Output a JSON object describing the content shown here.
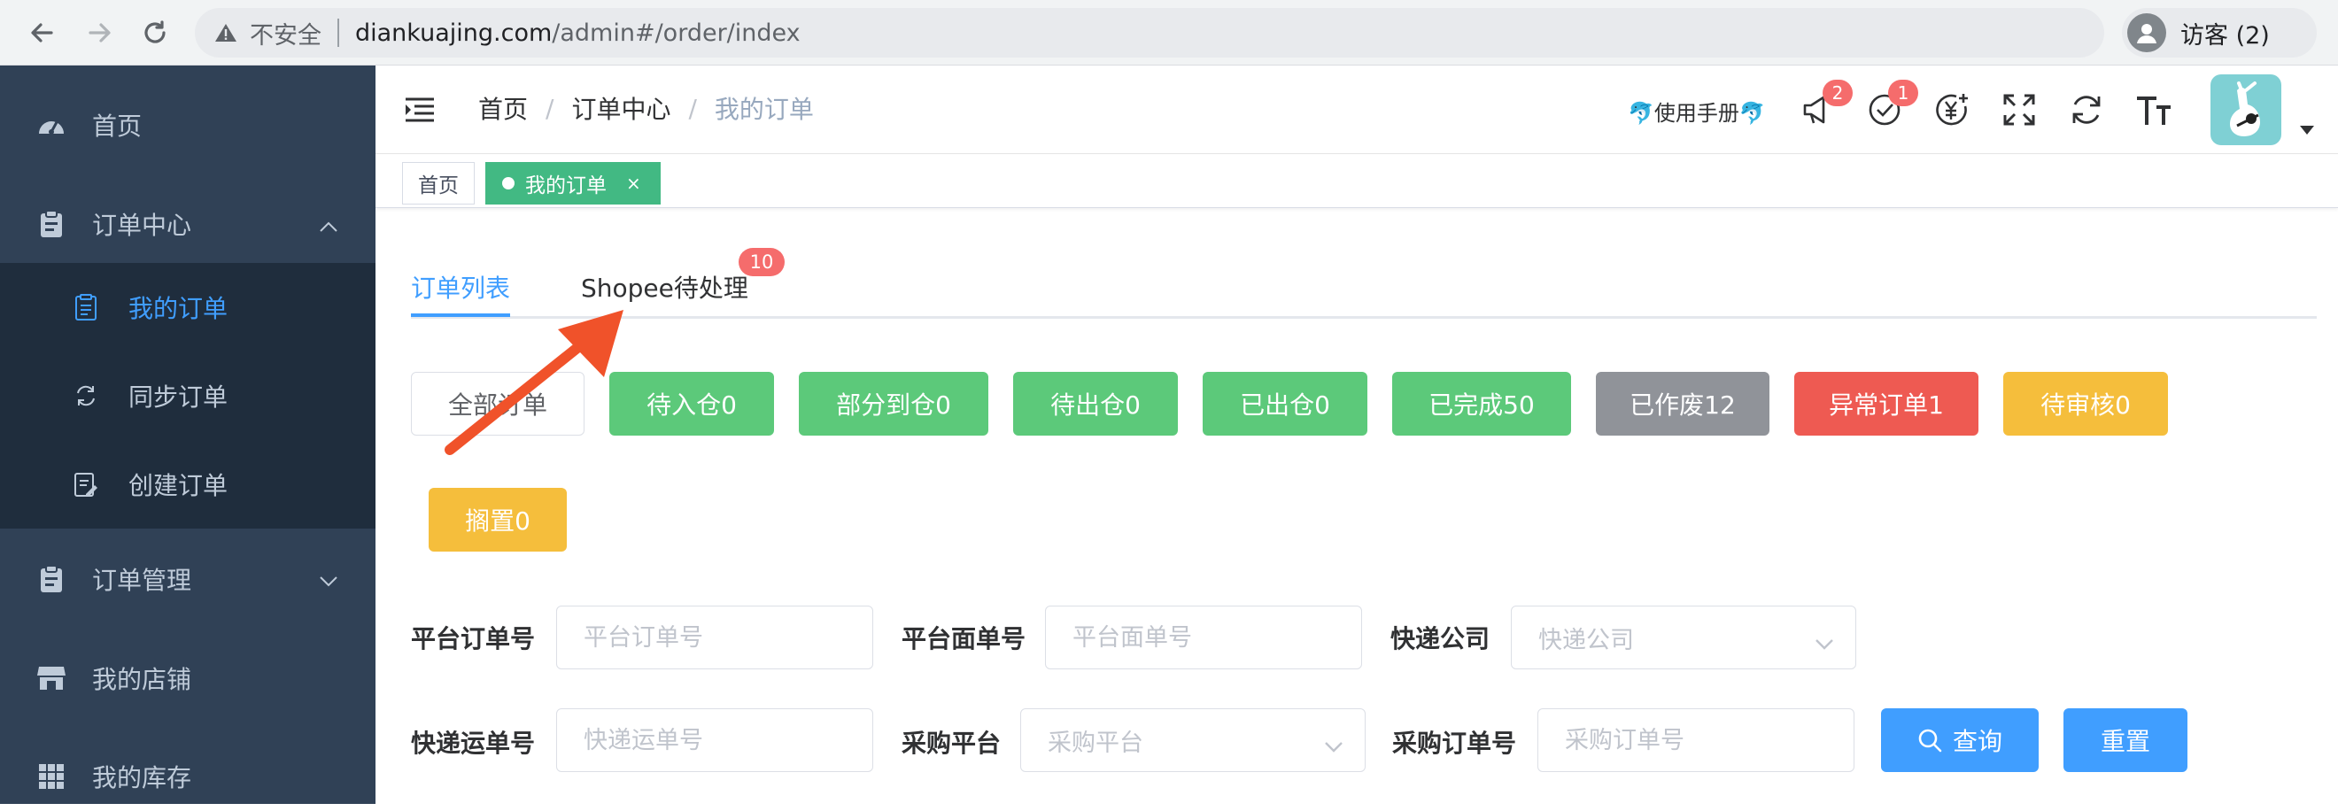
{
  "browser": {
    "security_label": "不安全",
    "url_host": "diankuajing.com",
    "url_path": "/admin#/order/index",
    "profile_label": "访客 (2)"
  },
  "sidebar": {
    "items": [
      {
        "label": "首页",
        "icon": "dashboard-icon"
      },
      {
        "label": "订单中心",
        "icon": "clipboard-icon",
        "expanded": true
      },
      {
        "label": "订单管理",
        "icon": "clipboard-icon",
        "expanded": false
      },
      {
        "label": "我的店铺",
        "icon": "store-icon"
      },
      {
        "label": "我的库存",
        "icon": "grid-icon"
      }
    ],
    "submenu": [
      {
        "label": "我的订单",
        "icon": "document-icon",
        "active": true
      },
      {
        "label": "同步订单",
        "icon": "sync-icon"
      },
      {
        "label": "创建订单",
        "icon": "edit-document-icon"
      }
    ]
  },
  "header": {
    "breadcrumb": [
      "首页",
      "订单中心",
      "我的订单"
    ],
    "manual_link": "🐬使用手册🐬",
    "notification_count": "2",
    "todo_count": "1"
  },
  "tags_view": {
    "home": "首页",
    "active": "我的订单",
    "close": "×"
  },
  "tabs": {
    "list": "订单列表",
    "shopee": "Shopee待处理",
    "shopee_badge": "10"
  },
  "status_buttons": [
    "全部订单",
    "待入仓0",
    "部分到仓0",
    "待出仓0",
    "已出仓0",
    "已完成50",
    "已作废12",
    "异常订单1",
    "待审核0",
    "搁置0"
  ],
  "filters": {
    "platform_order_label": "平台订单号",
    "platform_order_placeholder": "平台订单号",
    "platform_sheet_label": "平台面单号",
    "platform_sheet_placeholder": "平台面单号",
    "courier_label": "快递公司",
    "courier_placeholder": "快递公司",
    "tracking_label": "快递运单号",
    "tracking_placeholder": "快递运单号",
    "purchase_platform_label": "采购平台",
    "purchase_platform_placeholder": "采购平台",
    "purchase_order_label": "采购订单号",
    "purchase_order_placeholder": "采购订单号",
    "search_button": "查询",
    "reset_button": "重置"
  },
  "colors": {
    "sidebar_bg": "#304156",
    "submenu_bg": "#1f2d3d",
    "primary": "#409eff",
    "success": "#5cc97a",
    "danger": "#ee5a52",
    "warning": "#f5be3c",
    "info": "#909399",
    "tag_active": "#42b983",
    "arrow": "#f0522a"
  }
}
